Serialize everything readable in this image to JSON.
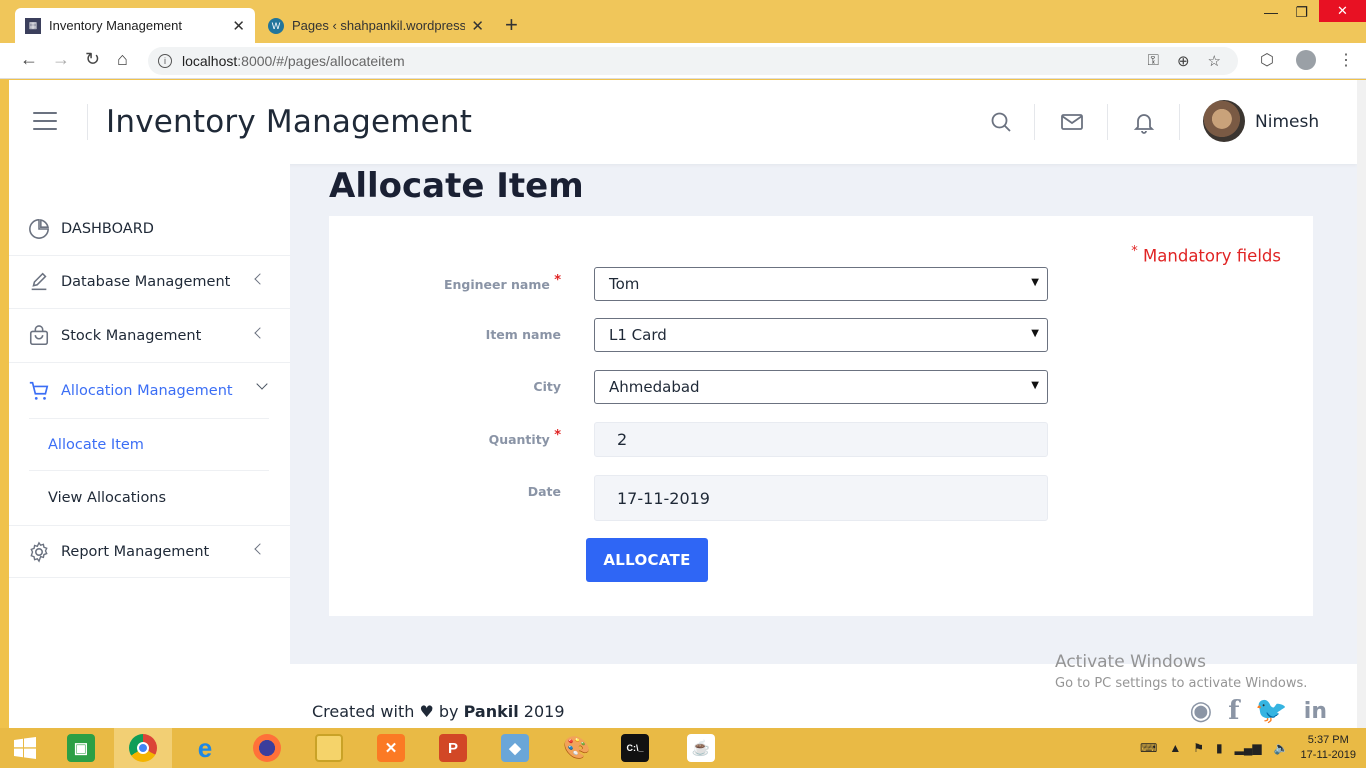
{
  "browser": {
    "tabs": [
      {
        "title": "Inventory Management",
        "active": true,
        "icon": "app-favicon"
      },
      {
        "title": "Pages ‹ shahpankil.wordpress.co",
        "active": false,
        "icon": "wordpress-icon"
      }
    ],
    "url_host": "localhost",
    "url_path": ":8000/#/pages/allocateitem"
  },
  "header": {
    "title": "Inventory Management",
    "user_name": "Nimesh"
  },
  "sidebar": {
    "items": [
      {
        "label": "DASHBOARD",
        "icon": "pie-chart-icon"
      },
      {
        "label": "Database Management",
        "icon": "edit-icon"
      },
      {
        "label": "Stock Management",
        "icon": "shopping-bag-icon"
      },
      {
        "label": "Allocation Management",
        "icon": "cart-icon",
        "active": true
      },
      {
        "label": "Report Management",
        "icon": "gear-icon"
      }
    ],
    "subitems": [
      {
        "label": "Allocate Item",
        "active": true
      },
      {
        "label": "View Allocations"
      }
    ]
  },
  "page": {
    "title": "Allocate Item",
    "mandatory_note": "Mandatory fields",
    "form": {
      "engineer_label": "Engineer name",
      "engineer_value": "Tom",
      "item_label": "Item name",
      "item_value": "L1 Card",
      "city_label": "City",
      "city_value": "Ahmedabad",
      "quantity_label": "Quantity",
      "quantity_value": "2",
      "date_label": "Date",
      "date_value": "17-11-2019",
      "submit_label": "ALLOCATE"
    }
  },
  "footer": {
    "prefix": "Created with",
    "heart": "♥",
    "by": "by",
    "author": "Pankil",
    "year": "2019"
  },
  "watermark": {
    "line1": "Activate Windows",
    "line2": "Go to PC settings to activate Windows."
  },
  "taskbar": {
    "time": "5:37 PM",
    "date": "17-11-2019"
  },
  "colors": {
    "accent": "#2f66f5",
    "active_nav": "#3b6ef5",
    "mandatory": "#e02424",
    "taskbar": "#e9ba45"
  }
}
